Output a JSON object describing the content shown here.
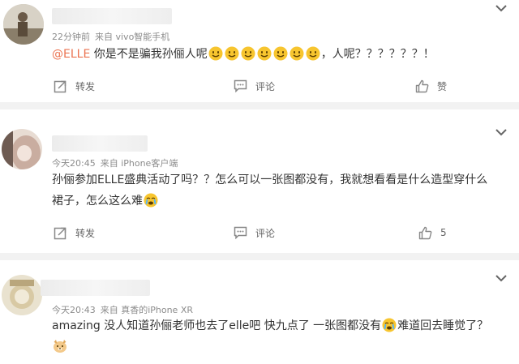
{
  "comments": [
    {
      "time": "22分钟前",
      "source": "来自 vivo智能手机",
      "mention": "@ELLE",
      "text_before": " 你是不是骗我孙俪人呢",
      "smile_count": 7,
      "text_after": "，人呢？？？？？？！",
      "actions": {
        "repost": "转发",
        "comment": "评论",
        "like": "赞"
      }
    },
    {
      "time": "今天20:45",
      "source": "来自 iPhone客户端",
      "line1": "孙俪参加ELLE盛典活动了吗？？怎么可以一张图都没有，我就想看看是什么造型穿什么",
      "line2": "裙子，怎么这么难",
      "actions": {
        "repost": "转发",
        "comment": "评论",
        "like": "5"
      }
    },
    {
      "time": "今天20:43",
      "source": "来自 真香的iPhone XR",
      "line1_before": "amazing 没人知道孙俪老师也去了elle吧 快九点了 一张图都没有",
      "line1_after": "难道回去睡觉了？"
    }
  ],
  "icons": [
    "chevron-down-icon",
    "repost-icon",
    "comment-icon",
    "like-icon",
    "smile-emoji-icon",
    "cry-emoji-icon",
    "dog-emoji-icon"
  ]
}
